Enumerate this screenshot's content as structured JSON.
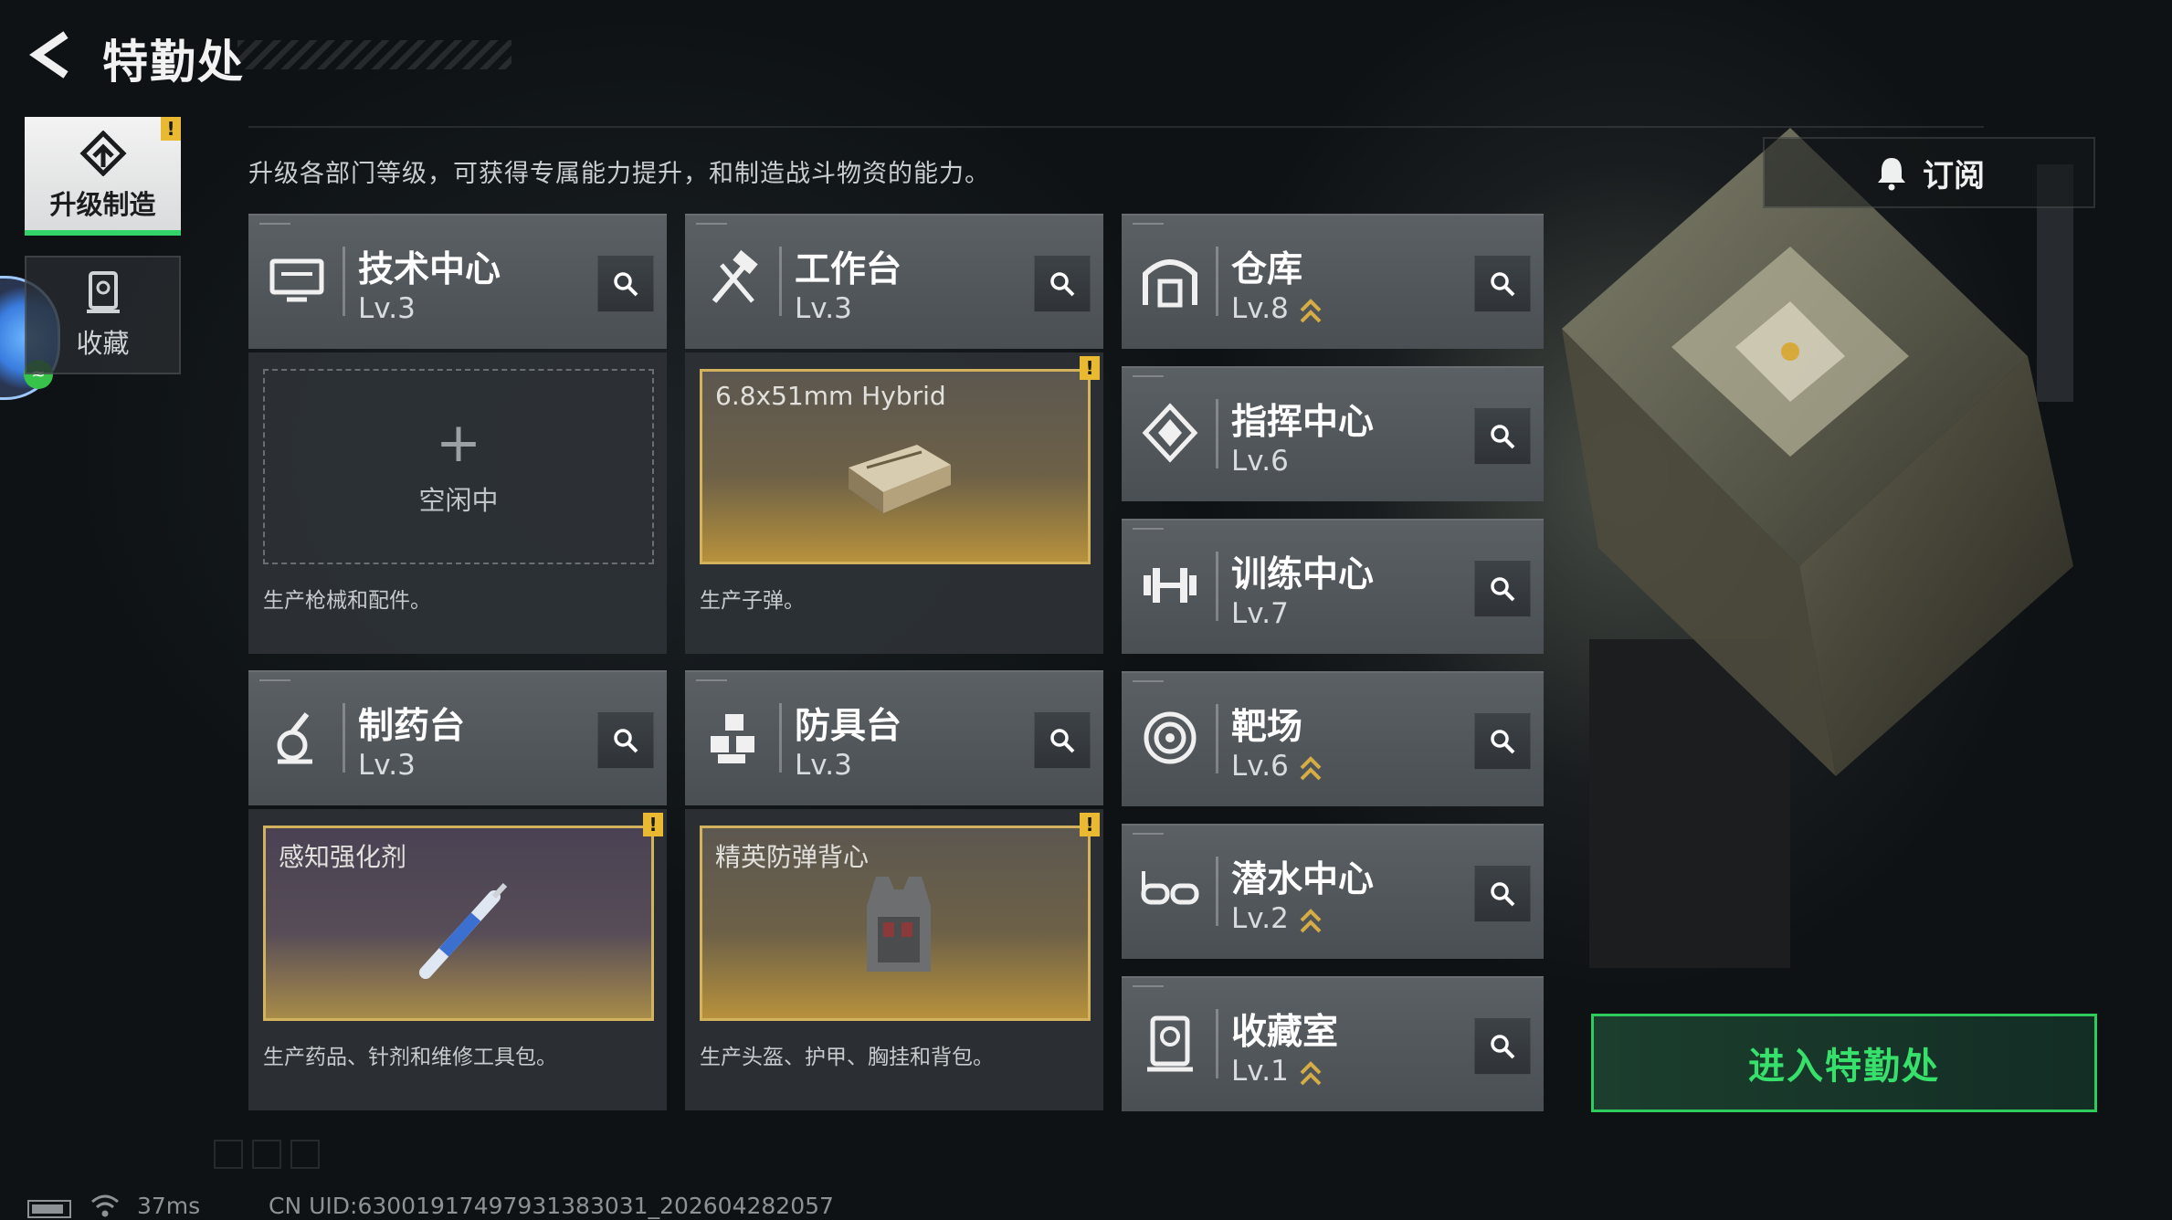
{
  "header": {
    "title": "特勤处",
    "back_icon": "back-arrow-icon"
  },
  "sidebar": {
    "tabs": [
      {
        "label": "升级制造",
        "icon": "upgrade-icon",
        "active": true,
        "warning": "!"
      },
      {
        "label": "收藏",
        "icon": "collection-icon",
        "active": false
      }
    ]
  },
  "description": "升级各部门等级，可获得专属能力提升，和制造战斗物资的能力。",
  "subscribe": {
    "label": "订阅",
    "icon": "bell-icon"
  },
  "departments": {
    "tech": {
      "name": "技术中心",
      "level": "Lv.3",
      "icon": "computer-icon"
    },
    "workbench": {
      "name": "工作台",
      "level": "Lv.3",
      "icon": "hammer-icon"
    },
    "pharmacy": {
      "name": "制药台",
      "level": "Lv.3",
      "icon": "microscope-icon"
    },
    "armor": {
      "name": "防具台",
      "level": "Lv.3",
      "icon": "armor-icon"
    },
    "warehouse": {
      "name": "仓库",
      "level": "Lv.8",
      "icon": "warehouse-icon",
      "upgradable": true
    },
    "command": {
      "name": "指挥中心",
      "level": "Lv.6",
      "icon": "command-icon",
      "upgradable": false
    },
    "training": {
      "name": "训练中心",
      "level": "Lv.7",
      "icon": "dumbbell-icon",
      "upgradable": false
    },
    "range": {
      "name": "靶场",
      "level": "Lv.6",
      "icon": "target-icon",
      "upgradable": true
    },
    "diving": {
      "name": "潜水中心",
      "level": "Lv.2",
      "icon": "goggles-icon",
      "upgradable": true
    },
    "collection_room": {
      "name": "收藏室",
      "level": "Lv.1",
      "icon": "trophy-icon",
      "upgradable": true
    }
  },
  "production": {
    "tech": {
      "status": "空闲中",
      "note": "生产枪械和配件。"
    },
    "workbench": {
      "item": "6.8x51mm Hybrid",
      "note": "生产子弹。",
      "warning": "!"
    },
    "pharmacy": {
      "item": "感知强化剂",
      "note": "生产药品、针剂和维修工具包。",
      "warning": "!"
    },
    "armor": {
      "item": "精英防弹背心",
      "note": "生产头盔、护甲、胸挂和背包。",
      "warning": "!"
    }
  },
  "enter_button": {
    "label": "进入特勤处"
  },
  "status_bar": {
    "ping": "37ms",
    "uid": "CN UID:63001917497931383031_202604282057"
  },
  "colors": {
    "accent_green": "#2ecc5c",
    "warning_yellow": "#e8b931",
    "item_gold": "#d3b25e"
  }
}
